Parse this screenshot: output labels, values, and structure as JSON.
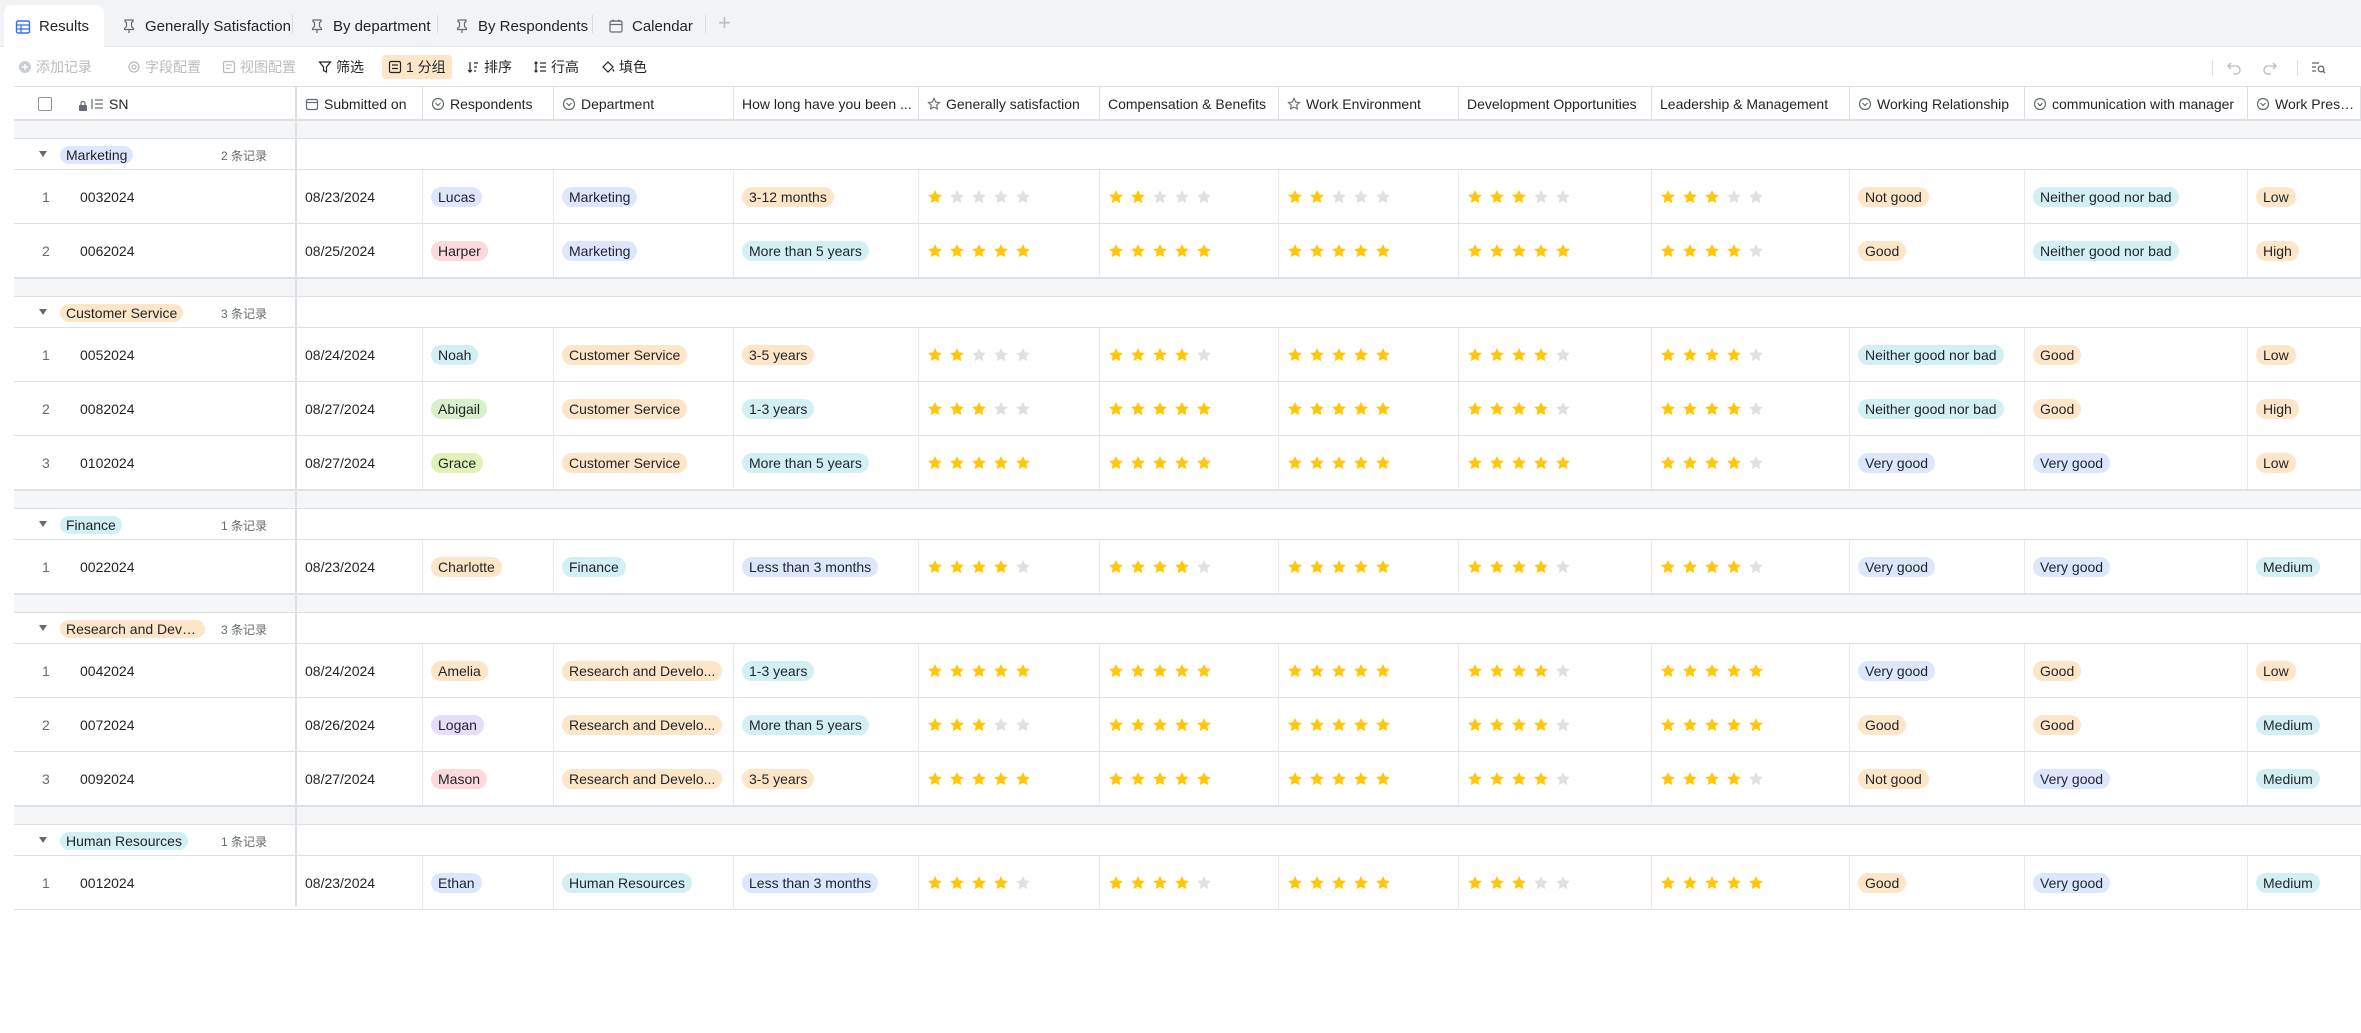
{
  "tabs": [
    {
      "label": "Results",
      "icon": "grid-table-icon",
      "active": true
    },
    {
      "label": "Generally Satisfaction",
      "icon": "pin-icon",
      "active": false
    },
    {
      "label": "By department",
      "icon": "pin-icon",
      "active": false
    },
    {
      "label": "By Respondents",
      "icon": "pin-icon",
      "active": false
    },
    {
      "label": "Calendar",
      "icon": "calendar-icon",
      "active": false
    }
  ],
  "toolbar": {
    "add_record": "添加记录",
    "field_config": "字段配置",
    "view_config": "视图配置",
    "filter": "筛选",
    "group": "1 分组",
    "sort": "排序",
    "row_height": "行高",
    "fill_color": "填色"
  },
  "columns": [
    {
      "key": "sn",
      "label": "SN",
      "icon": "number-icon"
    },
    {
      "key": "submitted",
      "label": "Submitted on",
      "icon": "calendar-icon"
    },
    {
      "key": "respondent",
      "label": "Respondents",
      "icon": "single-select-icon"
    },
    {
      "key": "department",
      "label": "Department",
      "icon": "single-select-icon"
    },
    {
      "key": "tenure",
      "label": "How long have you been ...",
      "icon": ""
    },
    {
      "key": "general",
      "label": "Generally satisfaction",
      "icon": "star-icon"
    },
    {
      "key": "comp",
      "label": "Compensation & Benefits",
      "icon": ""
    },
    {
      "key": "env",
      "label": "Work Environment",
      "icon": "star-icon"
    },
    {
      "key": "dev",
      "label": "Development Opportunities",
      "icon": ""
    },
    {
      "key": "lead",
      "label": "Leadership & Management",
      "icon": ""
    },
    {
      "key": "relation",
      "label": "Working Relationship",
      "icon": "single-select-icon"
    },
    {
      "key": "comm",
      "label": "communication with manager",
      "icon": "single-select-icon"
    },
    {
      "key": "pressure",
      "label": "Work Pressure",
      "icon": "single-select-icon"
    }
  ],
  "colors": {
    "blue": "#dce7fe",
    "cyan": "#d2f0f3",
    "green": "#d6f0ca",
    "orange": "#fde6c8",
    "pink": "#fbd9dc",
    "purple": "#e6dcfb",
    "lime": "#e2f2b6",
    "star_on": "#ffc60a",
    "star_off": "#dee0e3"
  },
  "groups": [
    {
      "name": "Marketing",
      "color": "blue",
      "count": "2 条记录",
      "rows": [
        {
          "idx": "1",
          "sn": "0032024",
          "submitted": "08/23/2024",
          "respondent": {
            "text": "Lucas",
            "color": "blue"
          },
          "department": {
            "text": "Marketing",
            "color": "blue"
          },
          "tenure": {
            "text": "3-12 months",
            "color": "orange"
          },
          "general": 1,
          "comp": 2,
          "env": 2,
          "dev": 3,
          "lead": 3,
          "relation": {
            "text": "Not good",
            "color": "orange"
          },
          "comm": {
            "text": "Neither good nor bad",
            "color": "cyan"
          },
          "pressure": {
            "text": "Low",
            "color": "orange"
          }
        },
        {
          "idx": "2",
          "sn": "0062024",
          "submitted": "08/25/2024",
          "respondent": {
            "text": "Harper",
            "color": "pink"
          },
          "department": {
            "text": "Marketing",
            "color": "blue"
          },
          "tenure": {
            "text": "More than 5 years",
            "color": "cyan"
          },
          "general": 5,
          "comp": 5,
          "env": 5,
          "dev": 5,
          "lead": 4,
          "relation": {
            "text": "Good",
            "color": "orange"
          },
          "comm": {
            "text": "Neither good nor bad",
            "color": "cyan"
          },
          "pressure": {
            "text": "High",
            "color": "orange"
          }
        }
      ]
    },
    {
      "name": "Customer Service",
      "color": "orange",
      "count": "3 条记录",
      "rows": [
        {
          "idx": "1",
          "sn": "0052024",
          "submitted": "08/24/2024",
          "respondent": {
            "text": "Noah",
            "color": "cyan"
          },
          "department": {
            "text": "Customer Service",
            "color": "orange"
          },
          "tenure": {
            "text": "3-5 years",
            "color": "orange"
          },
          "general": 2,
          "comp": 4,
          "env": 5,
          "dev": 4,
          "lead": 4,
          "relation": {
            "text": "Neither good nor bad",
            "color": "cyan"
          },
          "comm": {
            "text": "Good",
            "color": "orange"
          },
          "pressure": {
            "text": "Low",
            "color": "orange"
          }
        },
        {
          "idx": "2",
          "sn": "0082024",
          "submitted": "08/27/2024",
          "respondent": {
            "text": "Abigail",
            "color": "green"
          },
          "department": {
            "text": "Customer Service",
            "color": "orange"
          },
          "tenure": {
            "text": "1-3 years",
            "color": "cyan"
          },
          "general": 3,
          "comp": 5,
          "env": 5,
          "dev": 4,
          "lead": 4,
          "relation": {
            "text": "Neither good nor bad",
            "color": "cyan"
          },
          "comm": {
            "text": "Good",
            "color": "orange"
          },
          "pressure": {
            "text": "High",
            "color": "orange"
          }
        },
        {
          "idx": "3",
          "sn": "0102024",
          "submitted": "08/27/2024",
          "respondent": {
            "text": "Grace",
            "color": "lime"
          },
          "department": {
            "text": "Customer Service",
            "color": "orange"
          },
          "tenure": {
            "text": "More than 5 years",
            "color": "cyan"
          },
          "general": 5,
          "comp": 5,
          "env": 5,
          "dev": 5,
          "lead": 4,
          "relation": {
            "text": "Very good",
            "color": "blue"
          },
          "comm": {
            "text": "Very good",
            "color": "blue"
          },
          "pressure": {
            "text": "Low",
            "color": "orange"
          }
        }
      ]
    },
    {
      "name": "Finance",
      "color": "cyan",
      "count": "1 条记录",
      "rows": [
        {
          "idx": "1",
          "sn": "0022024",
          "submitted": "08/23/2024",
          "respondent": {
            "text": "Charlotte",
            "color": "orange"
          },
          "department": {
            "text": "Finance",
            "color": "cyan"
          },
          "tenure": {
            "text": "Less than 3 months",
            "color": "blue"
          },
          "general": 4,
          "comp": 4,
          "env": 5,
          "dev": 4,
          "lead": 4,
          "relation": {
            "text": "Very good",
            "color": "blue"
          },
          "comm": {
            "text": "Very good",
            "color": "blue"
          },
          "pressure": {
            "text": "Medium",
            "color": "cyan"
          }
        }
      ]
    },
    {
      "name": "Research and Devel...",
      "color": "orange",
      "count": "3 条记录",
      "rows": [
        {
          "idx": "1",
          "sn": "0042024",
          "submitted": "08/24/2024",
          "respondent": {
            "text": "Amelia",
            "color": "orange"
          },
          "department": {
            "text": "Research and Develo...",
            "color": "orange"
          },
          "tenure": {
            "text": "1-3 years",
            "color": "cyan"
          },
          "general": 5,
          "comp": 5,
          "env": 5,
          "dev": 4,
          "lead": 5,
          "relation": {
            "text": "Very good",
            "color": "blue"
          },
          "comm": {
            "text": "Good",
            "color": "orange"
          },
          "pressure": {
            "text": "Low",
            "color": "orange"
          }
        },
        {
          "idx": "2",
          "sn": "0072024",
          "submitted": "08/26/2024",
          "respondent": {
            "text": "Logan",
            "color": "purple"
          },
          "department": {
            "text": "Research and Develo...",
            "color": "orange"
          },
          "tenure": {
            "text": "More than 5 years",
            "color": "cyan"
          },
          "general": 3,
          "comp": 5,
          "env": 5,
          "dev": 4,
          "lead": 5,
          "relation": {
            "text": "Good",
            "color": "orange"
          },
          "comm": {
            "text": "Good",
            "color": "orange"
          },
          "pressure": {
            "text": "Medium",
            "color": "cyan"
          }
        },
        {
          "idx": "3",
          "sn": "0092024",
          "submitted": "08/27/2024",
          "respondent": {
            "text": "Mason",
            "color": "pink"
          },
          "department": {
            "text": "Research and Develo...",
            "color": "orange"
          },
          "tenure": {
            "text": "3-5 years",
            "color": "orange"
          },
          "general": 5,
          "comp": 5,
          "env": 5,
          "dev": 4,
          "lead": 4,
          "relation": {
            "text": "Not good",
            "color": "orange"
          },
          "comm": {
            "text": "Very good",
            "color": "blue"
          },
          "pressure": {
            "text": "Medium",
            "color": "cyan"
          }
        }
      ]
    },
    {
      "name": "Human Resources",
      "color": "cyan",
      "count": "1 条记录",
      "rows": [
        {
          "idx": "1",
          "sn": "0012024",
          "submitted": "08/23/2024",
          "respondent": {
            "text": "Ethan",
            "color": "blue"
          },
          "department": {
            "text": "Human Resources",
            "color": "cyan"
          },
          "tenure": {
            "text": "Less than 3 months",
            "color": "blue"
          },
          "general": 4,
          "comp": 4,
          "env": 5,
          "dev": 3,
          "lead": 5,
          "relation": {
            "text": "Good",
            "color": "orange"
          },
          "comm": {
            "text": "Very good",
            "color": "blue"
          },
          "pressure": {
            "text": "Medium",
            "color": "cyan"
          }
        }
      ]
    }
  ]
}
